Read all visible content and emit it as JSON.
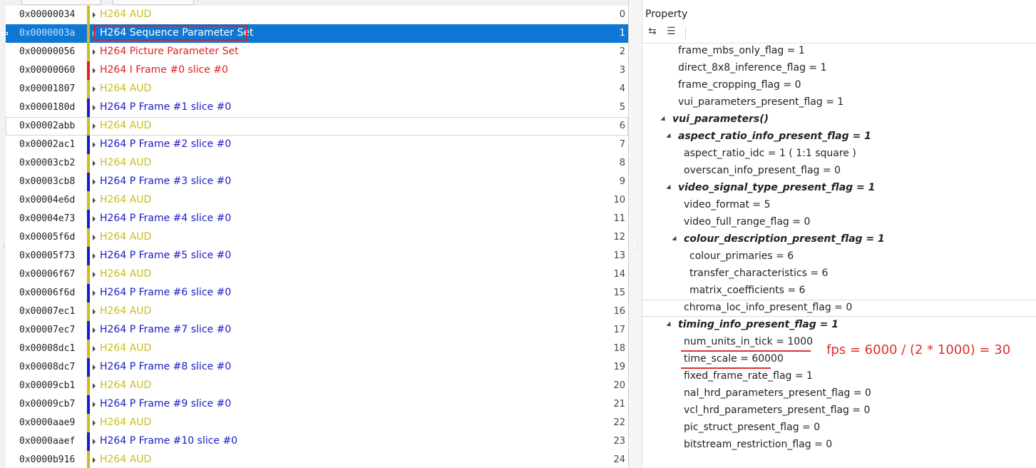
{
  "frames_panel": {
    "rows": [
      {
        "offset": "0x00000034",
        "label": "H264 AUD",
        "index": "0",
        "color": "#c8bd1e",
        "bar": "#c8bd1e"
      },
      {
        "offset": "0x0000003a",
        "label": "H264 Sequence Parameter Set",
        "index": "1",
        "color": "#ffffff",
        "bar": "#c8bd1e",
        "selected": true
      },
      {
        "offset": "0x00000056",
        "label": "H264 Picture Parameter Set",
        "index": "2",
        "color": "#e02020",
        "bar": "#c8bd1e"
      },
      {
        "offset": "0x00000060",
        "label": "H264 I Frame #0 slice #0",
        "index": "3",
        "color": "#e02020",
        "bar": "#e02020"
      },
      {
        "offset": "0x00001807",
        "label": "H264 AUD",
        "index": "4",
        "color": "#c8bd1e",
        "bar": "#c8bd1e"
      },
      {
        "offset": "0x0000180d",
        "label": "H264 P Frame #1 slice #0",
        "index": "5",
        "color": "#1a1ac8",
        "bar": "#1a1ac8"
      },
      {
        "offset": "0x00002abb",
        "label": "H264 AUD",
        "index": "6",
        "color": "#c8bd1e",
        "bar": "#c8bd1e",
        "outlined": true
      },
      {
        "offset": "0x00002ac1",
        "label": "H264 P Frame #2 slice #0",
        "index": "7",
        "color": "#1a1ac8",
        "bar": "#1a1ac8"
      },
      {
        "offset": "0x00003cb2",
        "label": "H264 AUD",
        "index": "8",
        "color": "#c8bd1e",
        "bar": "#c8bd1e"
      },
      {
        "offset": "0x00003cb8",
        "label": "H264 P Frame #3 slice #0",
        "index": "9",
        "color": "#1a1ac8",
        "bar": "#1a1ac8"
      },
      {
        "offset": "0x00004e6d",
        "label": "H264 AUD",
        "index": "10",
        "color": "#c8bd1e",
        "bar": "#c8bd1e"
      },
      {
        "offset": "0x00004e73",
        "label": "H264 P Frame #4 slice #0",
        "index": "11",
        "color": "#1a1ac8",
        "bar": "#1a1ac8"
      },
      {
        "offset": "0x00005f6d",
        "label": "H264 AUD",
        "index": "12",
        "color": "#c8bd1e",
        "bar": "#c8bd1e"
      },
      {
        "offset": "0x00005f73",
        "label": "H264 P Frame #5 slice #0",
        "index": "13",
        "color": "#1a1ac8",
        "bar": "#1a1ac8"
      },
      {
        "offset": "0x00006f67",
        "label": "H264 AUD",
        "index": "14",
        "color": "#c8bd1e",
        "bar": "#c8bd1e"
      },
      {
        "offset": "0x00006f6d",
        "label": "H264 P Frame #6 slice #0",
        "index": "15",
        "color": "#1a1ac8",
        "bar": "#1a1ac8"
      },
      {
        "offset": "0x00007ec1",
        "label": "H264 AUD",
        "index": "16",
        "color": "#c8bd1e",
        "bar": "#c8bd1e"
      },
      {
        "offset": "0x00007ec7",
        "label": "H264 P Frame #7 slice #0",
        "index": "17",
        "color": "#1a1ac8",
        "bar": "#1a1ac8"
      },
      {
        "offset": "0x00008dc1",
        "label": "H264 AUD",
        "index": "18",
        "color": "#c8bd1e",
        "bar": "#c8bd1e"
      },
      {
        "offset": "0x00008dc7",
        "label": "H264 P Frame #8 slice #0",
        "index": "19",
        "color": "#1a1ac8",
        "bar": "#1a1ac8"
      },
      {
        "offset": "0x00009cb1",
        "label": "H264 AUD",
        "index": "20",
        "color": "#c8bd1e",
        "bar": "#c8bd1e"
      },
      {
        "offset": "0x00009cb7",
        "label": "H264 P Frame #9 slice #0",
        "index": "21",
        "color": "#1a1ac8",
        "bar": "#1a1ac8"
      },
      {
        "offset": "0x0000aae9",
        "label": "H264 AUD",
        "index": "22",
        "color": "#c8bd1e",
        "bar": "#c8bd1e"
      },
      {
        "offset": "0x0000aaef",
        "label": "H264 P Frame #10 slice #0",
        "index": "23",
        "color": "#1a1ac8",
        "bar": "#1a1ac8"
      },
      {
        "offset": "0x0000b916",
        "label": "H264 AUD",
        "index": "24",
        "color": "#c8bd1e",
        "bar": "#c8bd1e"
      }
    ]
  },
  "property_panel": {
    "title": "Property",
    "toolbar": [
      {
        "name": "swap-arrows-icon",
        "glyph": "⇆"
      },
      {
        "name": "tree-view-icon",
        "glyph": "☰"
      }
    ],
    "rows": [
      {
        "text": "frame_mbs_only_flag = 1",
        "level": 1
      },
      {
        "text": "direct_8x8_inference_flag = 1",
        "level": 1
      },
      {
        "text": "frame_cropping_flag = 0",
        "level": 1
      },
      {
        "text": "vui_parameters_present_flag = 1",
        "level": 1
      },
      {
        "text": "vui_parameters()",
        "level": 0,
        "bold": true,
        "expander": true
      },
      {
        "text": "aspect_ratio_info_present_flag = 1",
        "level": 1,
        "bold": true,
        "expander": true
      },
      {
        "text": "aspect_ratio_idc = 1 ( 1:1 square )",
        "level": 2
      },
      {
        "text": "overscan_info_present_flag = 0",
        "level": 2
      },
      {
        "text": "video_signal_type_present_flag = 1",
        "level": 1,
        "bold": true,
        "expander": true
      },
      {
        "text": "video_format = 5",
        "level": 3
      },
      {
        "text": "video_full_range_flag = 0",
        "level": 3
      },
      {
        "text": "colour_description_present_flag = 1",
        "level": 2,
        "bold": true,
        "expander": true
      },
      {
        "text": "colour_primaries = 6",
        "level": 4
      },
      {
        "text": "transfer_characteristics = 6",
        "level": 4
      },
      {
        "text": "matrix_coefficients = 6",
        "level": 4
      },
      {
        "text": "chroma_loc_info_present_flag = 0",
        "level": 2,
        "outlined": true
      },
      {
        "text": "timing_info_present_flag = 1",
        "level": 1,
        "bold": true,
        "expander": true
      },
      {
        "text": "num_units_in_tick = 1000",
        "level": 3,
        "underline": true
      },
      {
        "text": "time_scale = 60000",
        "level": 3,
        "underline": true
      },
      {
        "text": "fixed_frame_rate_flag = 1",
        "level": 3
      },
      {
        "text": "nal_hrd_parameters_present_flag = 0",
        "level": 2
      },
      {
        "text": "vcl_hrd_parameters_present_flag = 0",
        "level": 2
      },
      {
        "text": "pic_struct_present_flag = 0",
        "level": 2
      },
      {
        "text": "bitstream_restriction_flag = 0",
        "level": 2
      }
    ]
  },
  "annotation": {
    "text": "fps = 6000 / (2 * 1000) = 30",
    "color": "#e03030"
  }
}
